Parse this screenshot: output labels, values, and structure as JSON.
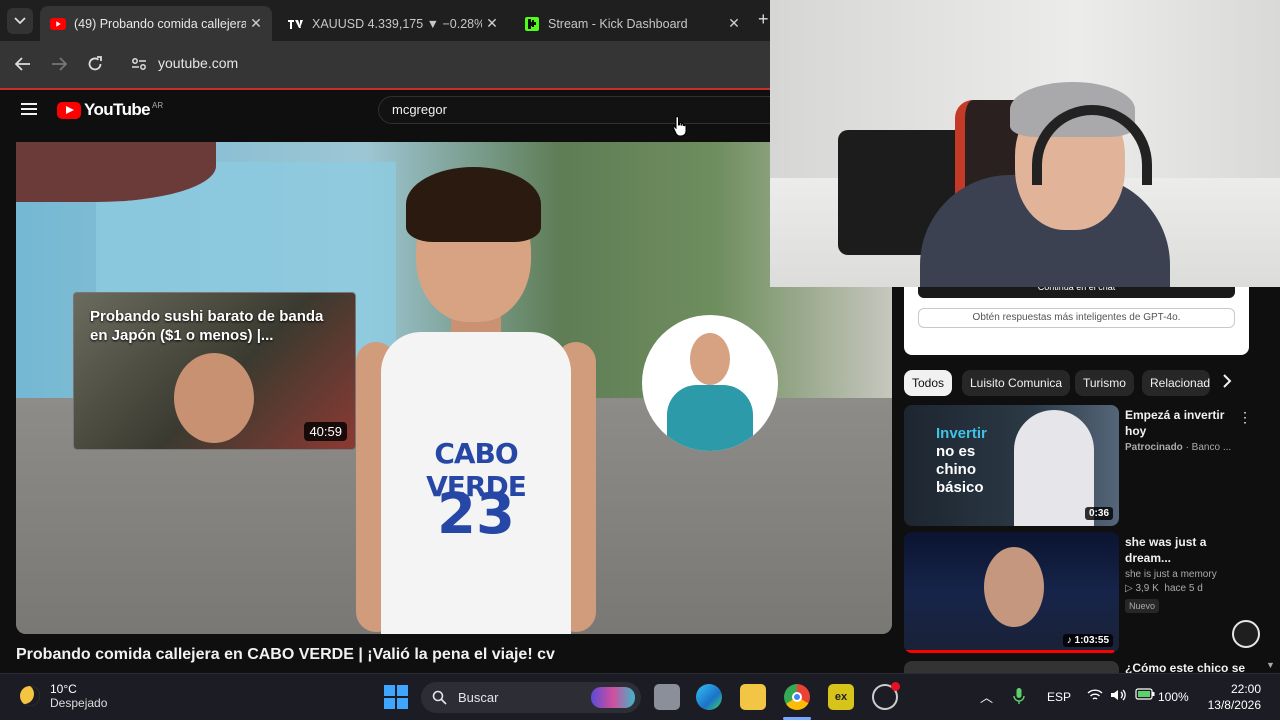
{
  "browser": {
    "tabs": [
      {
        "title": "(49) Probando comida callejera en",
        "active": true,
        "favicon": "youtube-icon"
      },
      {
        "title": "XAUUSD 4.339,175 ▼ −0.28% S",
        "active": false,
        "favicon": "tradingview-icon"
      },
      {
        "title": "Stream - Kick Dashboard",
        "active": false,
        "favicon": "kick-icon"
      }
    ],
    "url": "youtube.com"
  },
  "youtube": {
    "logo_text": "YouTube",
    "region": "AR",
    "search_value": "mcgregor",
    "video": {
      "title": "Probando comida callejera en CABO VERDE | ¡Valió la pena el viaje! cv",
      "jersey_name": "CABO VERDE",
      "jersey_number": "23",
      "endscreen_card": {
        "title": "Probando sushi barato de banda en Japón ($1 o menos) |...",
        "duration": "40:59"
      }
    },
    "chat_box": {
      "top_button": "Continúa en el chat",
      "gpt_button": "Obtén respuestas más inteligentes de GPT-4o."
    },
    "chips": [
      "Todos",
      "Luisito Comunica",
      "Turismo",
      "Relacionad"
    ],
    "recommendations": [
      {
        "title": "Empezá a invertir hoy",
        "channel": "Patrocinado",
        "channel_suffix": "· Banco ...",
        "duration": "0:36",
        "thumb_line1": "Invertir",
        "thumb_line2": "no es",
        "thumb_line3": "chino",
        "thumb_line4": "básico"
      },
      {
        "title": "she was just a dream...",
        "channel": "she is just a memory",
        "views": "3,9 K",
        "age": "hace 5 d",
        "badge": "Nuevo",
        "duration": "1:03:55"
      },
      {
        "title": "¿Cómo este chico se"
      }
    ]
  },
  "taskbar": {
    "weather_temp": "10°C",
    "weather_desc": "Despejado",
    "search_placeholder": "Buscar",
    "language": "ESP",
    "battery": "100%",
    "time": "22:00",
    "date": "13/8/2026"
  }
}
